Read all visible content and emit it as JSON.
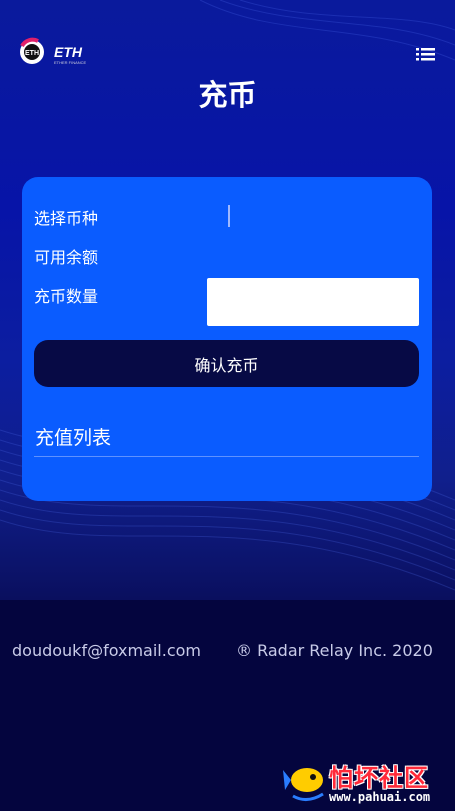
{
  "header": {
    "logo_text": "ETH",
    "logo_subtext": "ETHER FINANCE",
    "title": "充币"
  },
  "form": {
    "select_coin_label": "选择币种",
    "available_balance_label": "可用余额",
    "amount_label": "充币数量",
    "amount_value": "",
    "confirm_button": "确认充币"
  },
  "list": {
    "title": "充值列表"
  },
  "footer": {
    "email": "doudoukf@foxmail.com",
    "copyright": "® Radar Relay Inc. 2020"
  },
  "watermark": {
    "text": "怕坏社区",
    "url": "www.pahuai.com"
  },
  "colors": {
    "card": "#0a5cff",
    "button": "#070a45",
    "background_top": "#0a1a9c",
    "background_bottom": "#04053e"
  }
}
